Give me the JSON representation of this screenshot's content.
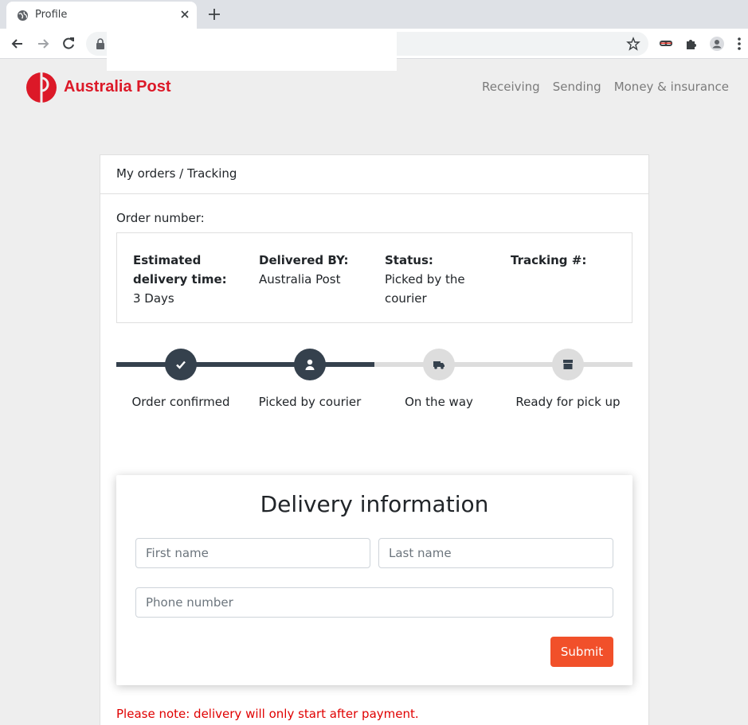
{
  "browser": {
    "tab_title": "Profile",
    "url": ""
  },
  "header": {
    "brand": "Australia Post",
    "brand_color": "#dc1928",
    "nav": [
      "Receiving",
      "Sending",
      "Money & insurance"
    ]
  },
  "card": {
    "breadcrumb": "My orders / Tracking",
    "order_number_label": "Order number:",
    "info": [
      {
        "label": "Estimated delivery time:",
        "value": "3 Days"
      },
      {
        "label": "Delivered BY:",
        "value": "Australia Post"
      },
      {
        "label": "Status:",
        "value": "Picked by the courier"
      },
      {
        "label": "Tracking #:",
        "value": ""
      }
    ],
    "steps": [
      {
        "label": "Order confirmed",
        "icon": "check-icon",
        "completed": true
      },
      {
        "label": "Picked by courier",
        "icon": "user-icon",
        "completed": true
      },
      {
        "label": "On the way",
        "icon": "truck-icon",
        "completed": false
      },
      {
        "label": "Ready for pick up",
        "icon": "box-icon",
        "completed": false
      }
    ],
    "progress_active_color": "#35414d",
    "progress_inactive_color": "#dddddd"
  },
  "form": {
    "title": "Delivery information",
    "first_name_placeholder": "First name",
    "last_name_placeholder": "Last name",
    "phone_placeholder": "Phone number",
    "submit_label": "Submit",
    "submit_color": "#f1502a"
  },
  "note": "Please note: delivery will only start after payment."
}
